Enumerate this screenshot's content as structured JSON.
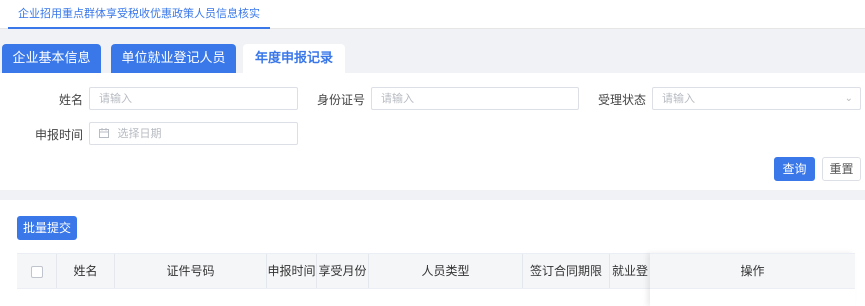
{
  "top_tab": {
    "label": "企业招用重点群体享受税收优惠政策人员信息核实"
  },
  "tabs": [
    {
      "label": "企业基本信息"
    },
    {
      "label": "单位就业登记人员"
    },
    {
      "label": "年度申报记录"
    }
  ],
  "form": {
    "name": {
      "label": "姓名",
      "placeholder": "请输入"
    },
    "id_number": {
      "label": "身份证号",
      "placeholder": "请输入"
    },
    "status": {
      "label": "受理状态",
      "placeholder": "请输入"
    },
    "date": {
      "label": "申报时间",
      "placeholder": "选择日期"
    },
    "query_button": "查询",
    "reset_button": "重置"
  },
  "batch_button": "批量提交",
  "table": {
    "columns": [
      "姓名",
      "证件号码",
      "申报时间",
      "享受月份",
      "人员类型",
      "签订合同期限",
      "就业登",
      "操作"
    ]
  },
  "colors": {
    "accent": "#3a78ea",
    "header_bg": "#f5f6f8",
    "page_bg": "#f0f2f5"
  }
}
